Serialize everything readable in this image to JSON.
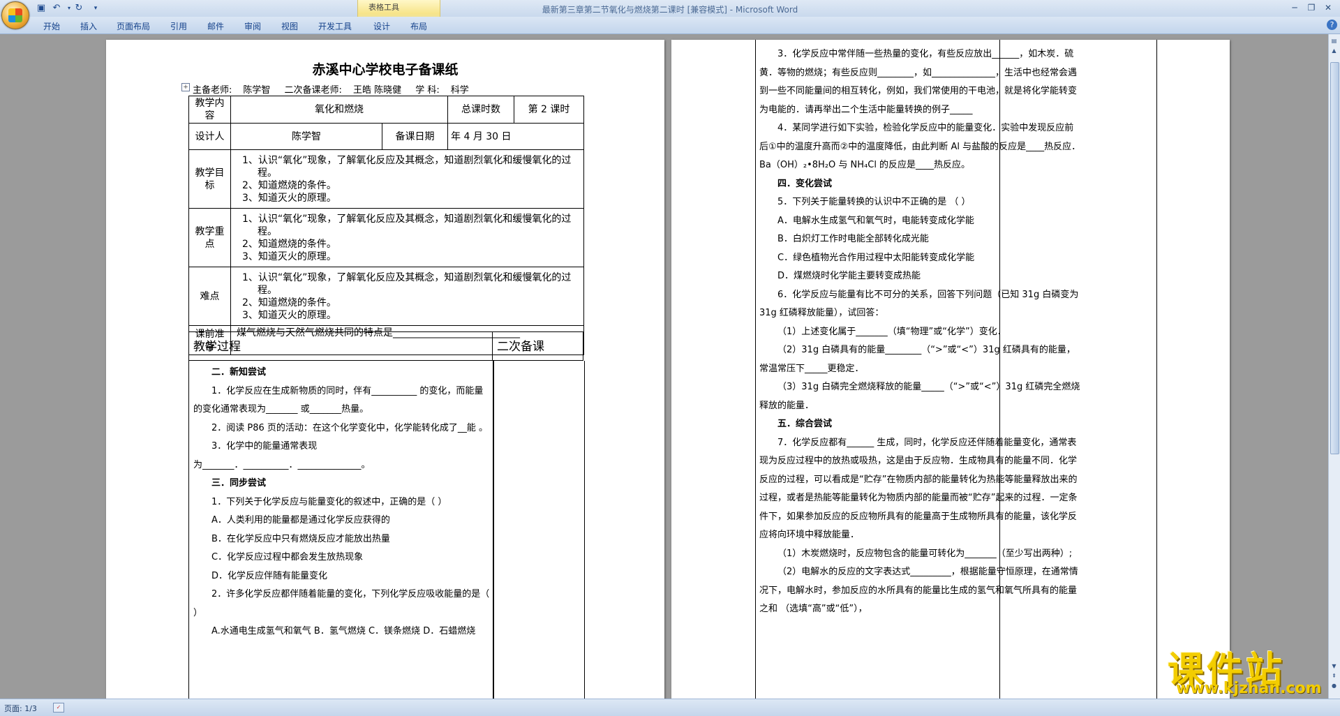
{
  "window": {
    "title": "最新第三章第二节氧化与燃烧第二课时 [兼容模式] - Microsoft Word",
    "context_tab_group": "表格工具"
  },
  "ribbon": {
    "tabs": [
      "开始",
      "插入",
      "页面布局",
      "引用",
      "邮件",
      "审阅",
      "视图",
      "开发工具",
      "设计",
      "布局"
    ]
  },
  "status": {
    "page": "页面: 1/3"
  },
  "watermark": {
    "name": "课件站",
    "url": "www.kjzhan.com"
  },
  "page1": {
    "heading": "赤溪中心学校电子备课纸",
    "meta": {
      "main_teacher_label": "主备老师:",
      "main_teacher": "陈学智",
      "second_teacher_label": "二次备课老师:",
      "second_teacher": "王皓 陈晓健",
      "subject_label": "学 科:",
      "subject": "科学"
    },
    "table": {
      "content_label": "教学内容",
      "content_value": "氧化和燃烧",
      "total_hours_label": "总课时数",
      "hour_value": "第 2 课时",
      "designer_label": "设计人",
      "designer_value": "陈学智",
      "prep_date_label": "备课日期",
      "prep_date_value": "年 4  月  30 日",
      "goals_label": "教学目标",
      "key_label": "教学重点",
      "difficulty_label": "难点",
      "items": [
        "1、认识“氧化”现象，了解氧化反应及其概念，知道剧烈氧化和缓慢氧化的过程。",
        "2、知道燃烧的条件。",
        "3、知道灭火的原理。"
      ],
      "pre_class_label": "课前准备",
      "pre_class_value": "煤气燃烧与天然气燃烧共同的特点是__________________________",
      "process_label": "教学过程",
      "second_prep_label": "二次备课"
    },
    "process": [
      {
        "cls": "head",
        "text": "二．新知尝试"
      },
      {
        "cls": "",
        "text": "1．化学反应在生成新物质的同时，伴有__________ 的变化，而能量的变化通常表现为_______ 或_______热量。"
      },
      {
        "cls": "",
        "text": "2．阅读 P86 页的活动：在这个化学变化中，化学能转化成了__能 。"
      },
      {
        "cls": "",
        "text": "3．化学中的能量通常表现"
      },
      {
        "cls": "flush",
        "text": "为_______．__________．______________。"
      },
      {
        "cls": "head",
        "text": "三．同步尝试"
      },
      {
        "cls": "",
        "text": "1．下列关于化学反应与能量变化的叙述中，正确的是（     ）"
      },
      {
        "cls": "",
        "text": "A．人类利用的能量都是通过化学反应获得的"
      },
      {
        "cls": "",
        "text": "B．在化学反应中只有燃烧反应才能放出热量"
      },
      {
        "cls": "",
        "text": "C．化学反应过程中都会发生放热现象"
      },
      {
        "cls": "",
        "text": "D．化学反应伴随有能量变化"
      },
      {
        "cls": "",
        "text": "2．许多化学反应都伴随着能量的变化，下列化学反应吸收能量的是（     ）"
      },
      {
        "cls": "",
        "text": "A.水通电生成氢气和氧气    B．氢气燃烧   C．镁条燃烧   D．石蜡燃烧"
      }
    ]
  },
  "page2": {
    "paragraphs": [
      {
        "cls": "",
        "text": "3．化学反应中常伴随一些热量的变化，有些反应放出______，如木炭．硫黄．等物的燃烧；有些反应则________，如______________，生活中也经常会遇到一些不同能量间的相互转化，例如，我们常使用的干电池，就是将化学能转变为电能的．请再举出二个生活中能量转换的例子_____"
      },
      {
        "cls": "",
        "text": "4．某同学进行如下实验，检验化学反应中的能量变化．实验中发现反应前后①中的温度升高而②中的温度降低，由此判断 Al 与盐酸的反应是____热反应．Ba（OH）₂•8H₂O 与 NH₄Cl 的反应是____热反应。"
      },
      {
        "cls": "head",
        "text": "四．变化尝试"
      },
      {
        "cls": "",
        "text": "5．下列关于能量转换的认识中不正确的是 （        ）"
      },
      {
        "cls": "",
        "text": "A．电解水生成氢气和氧气时，电能转变成化学能"
      },
      {
        "cls": "",
        "text": "B．白炽灯工作时电能全部转化成光能"
      },
      {
        "cls": "",
        "text": "C．绿色植物光合作用过程中太阳能转变成化学能"
      },
      {
        "cls": "",
        "text": "D．煤燃烧时化学能主要转变成热能"
      },
      {
        "cls": "",
        "text": "6．化学反应与能量有比不可分的关系，回答下列问题（已知 31g 白磷变为 31g 红磷释放能量），试回答："
      },
      {
        "cls": "",
        "text": "（1）上述变化属于_______（填“物理”或“化学”）变化．"
      },
      {
        "cls": "",
        "text": "（2）31g 白磷具有的能量________（“>”或“<”）31g 红磷具有的能量，常温常压下_____更稳定．"
      },
      {
        "cls": "",
        "text": "（3）31g 白磷完全燃烧释放的能量_____（“>”或“<”）31g 红磷完全燃烧释放的能量．"
      },
      {
        "cls": "head",
        "text": "五．综合尝试"
      },
      {
        "cls": "",
        "text": "7．化学反应都有______ 生成，同时，化学反应还伴随着能量变化，通常表现为反应过程中的放热或吸热，这是由于反应物．生成物具有的能量不同．化学反应的过程，可以看成是“贮存”在物质内部的能量转化为热能等能量释放出来的过程，或者是热能等能量转化为物质内部的能量而被“贮存”起来的过程．一定条件下，如果参加反应的反应物所具有的能量高于生成物所具有的能量，该化学反应将向环境中释放能量．"
      },
      {
        "cls": "",
        "text": "（1）木炭燃烧时，反应物包含的能量可转化为_______（至少写出两种）;"
      },
      {
        "cls": "",
        "text": "（2）电解水的反应的文字表达式_________，根据能量守恒原理，在通常情况下，电解水时，参加反应的水所具有的能量比生成的氢气和氧气所具有的能量之和         （选填“高”或“低”），"
      }
    ]
  }
}
